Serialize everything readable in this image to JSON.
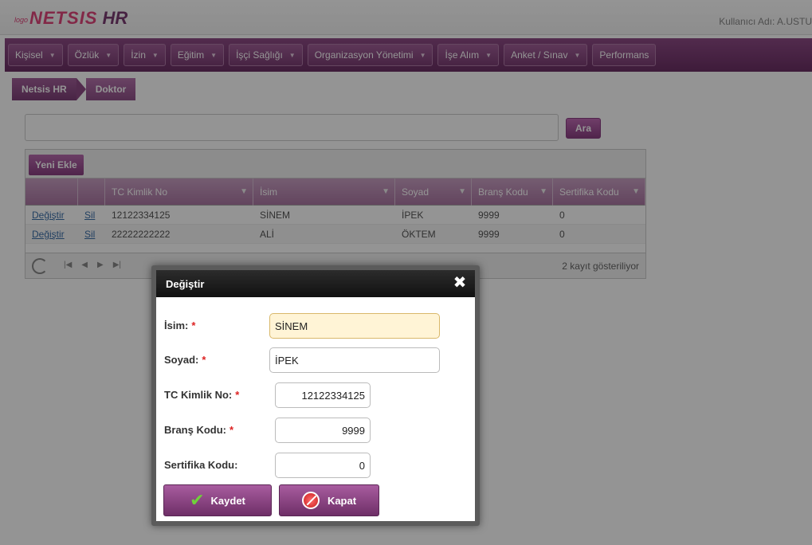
{
  "header": {
    "logo_small": "logo",
    "logo_main": "NETSIS",
    "logo_hr": "HR",
    "user_label": "Kullanıcı Adı: A.USTU"
  },
  "menu": [
    {
      "label": "Kişisel"
    },
    {
      "label": "Özlük"
    },
    {
      "label": "İzin"
    },
    {
      "label": "Eğitim"
    },
    {
      "label": "İşçi Sağlığı"
    },
    {
      "label": "Organizasyon Yönetimi"
    },
    {
      "label": "İşe Alım"
    },
    {
      "label": "Anket / Sınav"
    },
    {
      "label": "Performans"
    }
  ],
  "breadcrumb": {
    "root": "Netsis HR",
    "current": "Doktor"
  },
  "search": {
    "value": "",
    "button_label": "Ara"
  },
  "grid": {
    "add_label": "Yeni Ekle",
    "columns": [
      "",
      "",
      "TC Kimlik No",
      "İsim",
      "Soyad",
      "Branş Kodu",
      "Sertifika Kodu"
    ],
    "rows": [
      {
        "edit": "Değiştir",
        "delete": "Sil",
        "tc": "12122334125",
        "isim": "SİNEM",
        "soyad": "İPEK",
        "brans": "9999",
        "sertifika": "0"
      },
      {
        "edit": "Değiştir",
        "delete": "Sil",
        "tc": "22222222222",
        "isim": "ALİ",
        "soyad": "ÖKTEM",
        "brans": "9999",
        "sertifika": "0"
      }
    ],
    "record_count": "2 kayıt gösteriliyor"
  },
  "modal": {
    "title": "Değiştir",
    "fields": {
      "isim": {
        "label": "İsim:",
        "required": "*",
        "value": "SİNEM"
      },
      "soyad": {
        "label": "Soyad:",
        "required": "*",
        "value": "İPEK"
      },
      "tc": {
        "label": "TC Kimlik No:",
        "required": "*",
        "value": "12122334125"
      },
      "brans": {
        "label": "Branş Kodu:",
        "required": "*",
        "value": "9999"
      },
      "sertifika": {
        "label": "Sertifika Kodu:",
        "value": "0"
      }
    },
    "save_label": "Kaydet",
    "close_label": "Kapat"
  },
  "colors": {
    "brand_purple": "#7c3e75",
    "logo_pink": "#e0457b",
    "modal_title_bg": "#111111",
    "focus_field_bg": "#fff4d6"
  }
}
